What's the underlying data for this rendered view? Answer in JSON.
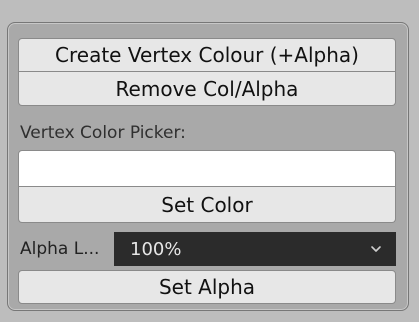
{
  "buttons": {
    "create_vertex_colour": "Create Vertex Colour (+Alpha)",
    "remove_col_alpha": "Remove Col/Alpha",
    "set_color": "Set Color",
    "set_alpha": "Set Alpha"
  },
  "picker": {
    "label": "Vertex Color Picker:",
    "color_value": "#ffffff"
  },
  "alpha": {
    "label": "Alpha L...",
    "selected_value": "100%"
  },
  "icons": {
    "dropdown": "chevron-down-icon"
  }
}
